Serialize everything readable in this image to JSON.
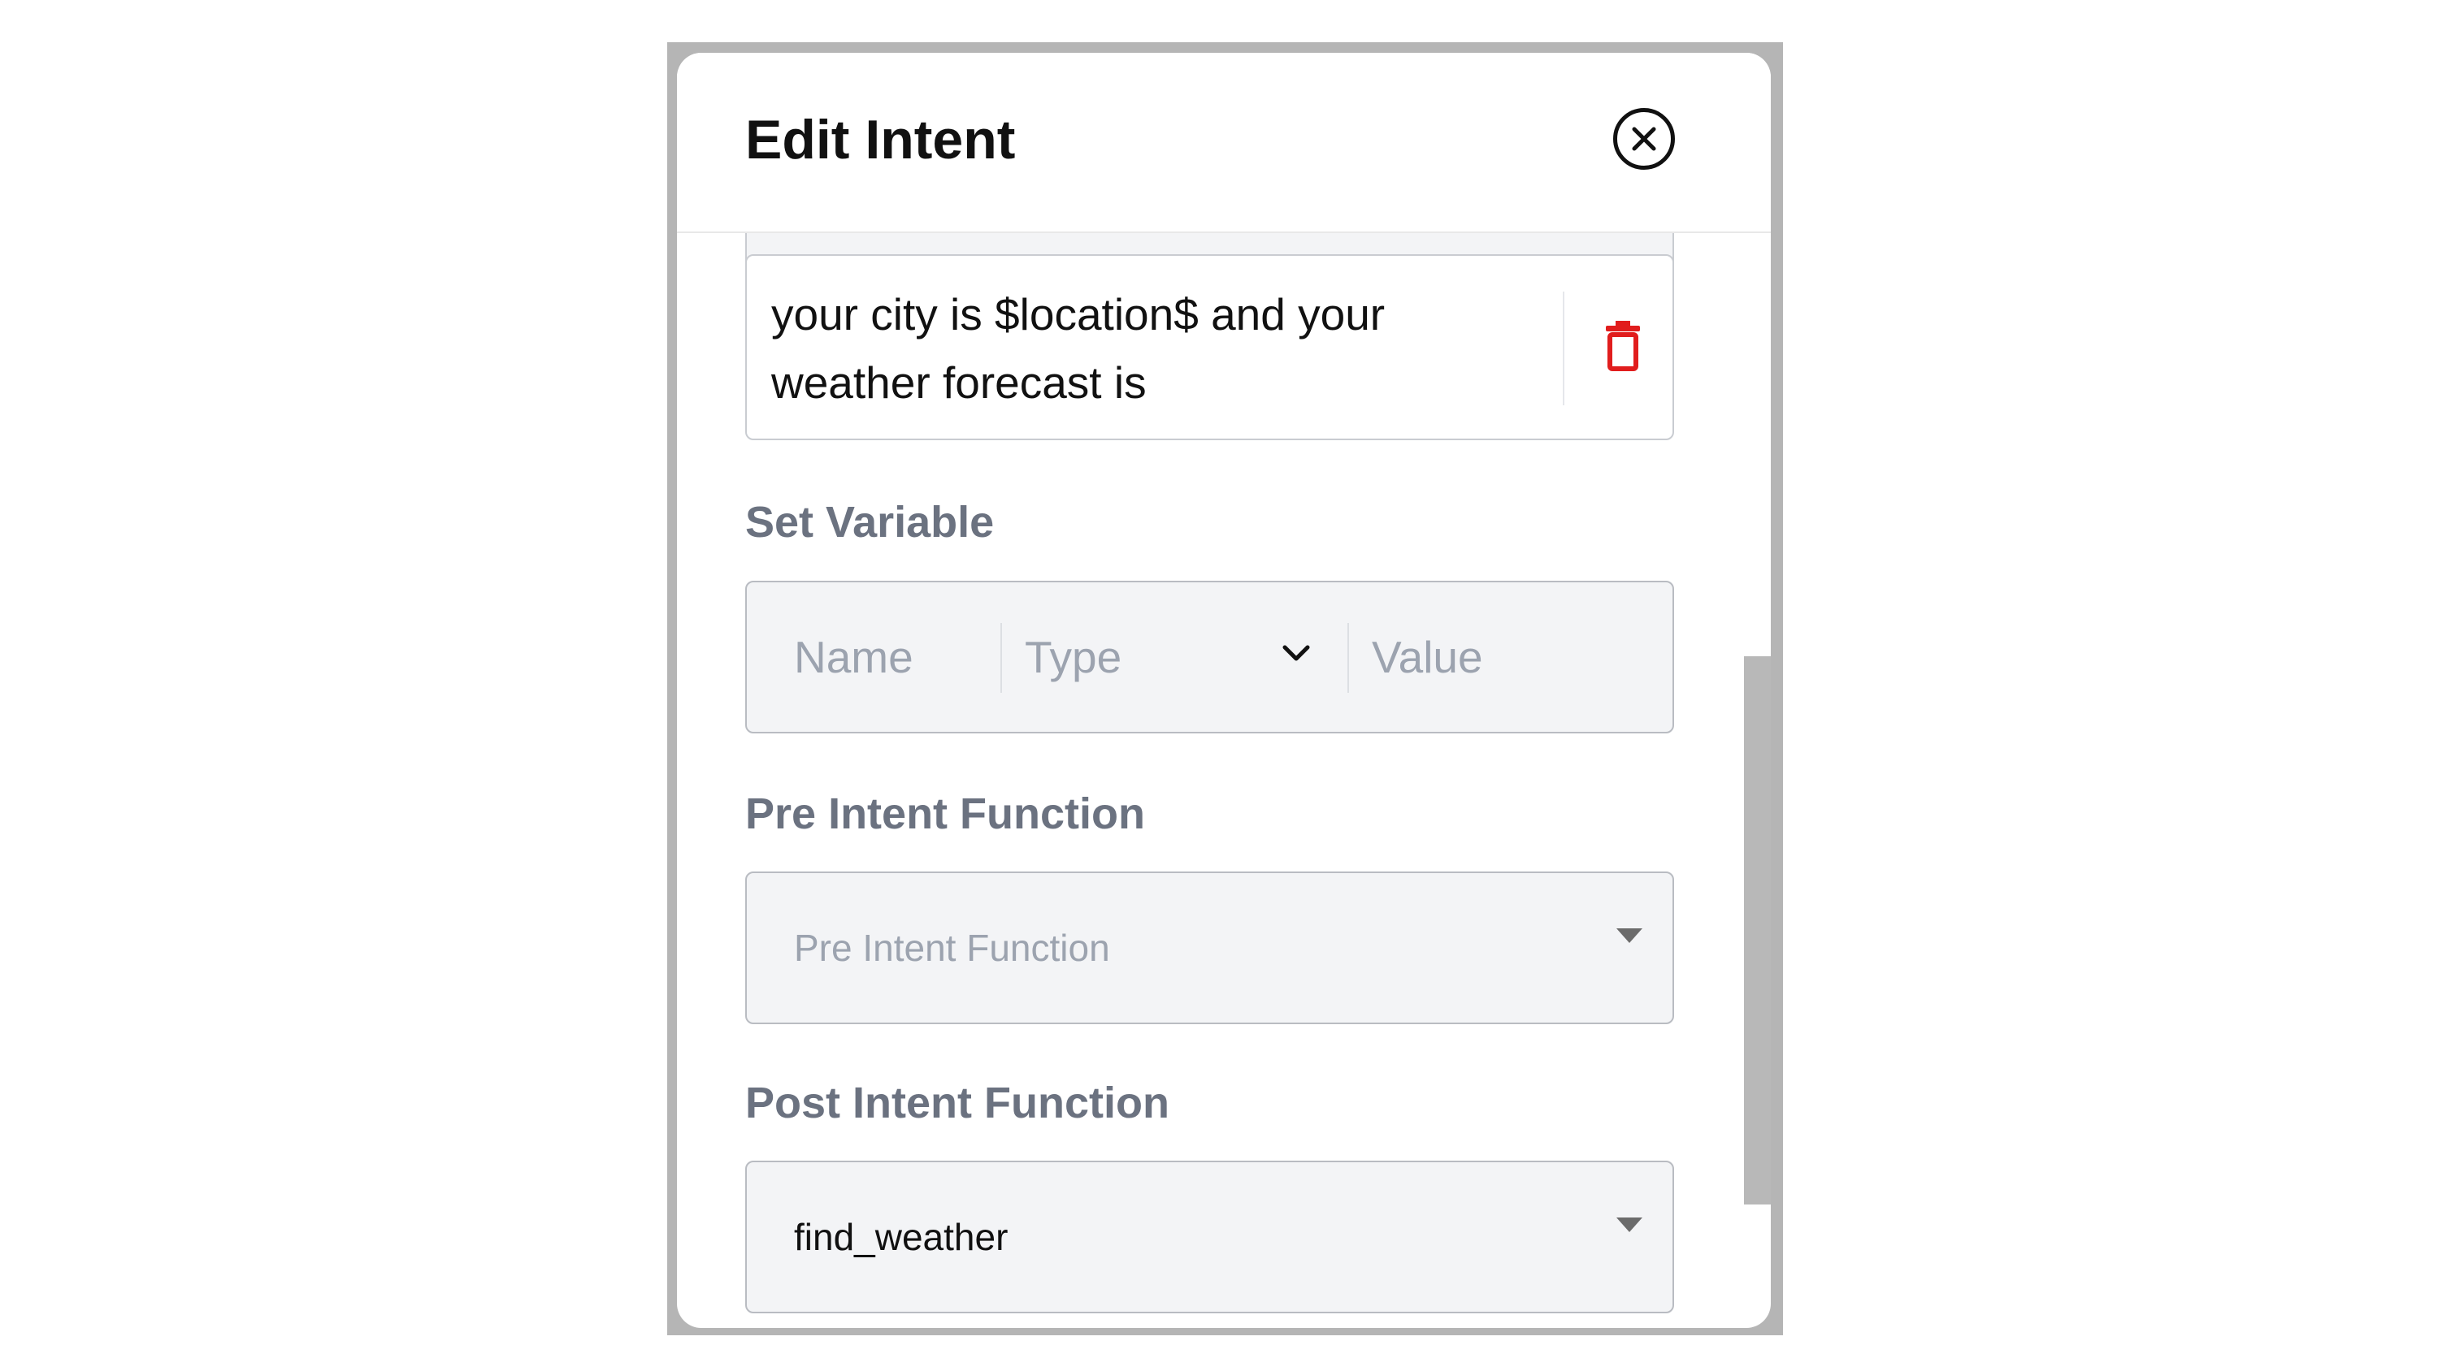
{
  "modal": {
    "title": "Edit Intent",
    "close_icon": "close-circle-icon",
    "response": {
      "text": "your city is $location$ and your weather forecast is",
      "delete_icon": "trash-icon",
      "delete_color": "#e11d1d"
    },
    "set_variable": {
      "label": "Set Variable",
      "name_placeholder": "Name",
      "type_placeholder": "Type",
      "value_placeholder": "Value"
    },
    "pre_intent": {
      "label": "Pre Intent Function",
      "placeholder": "Pre Intent Function"
    },
    "post_intent": {
      "label": "Post Intent Function",
      "value": "find_weather"
    }
  }
}
